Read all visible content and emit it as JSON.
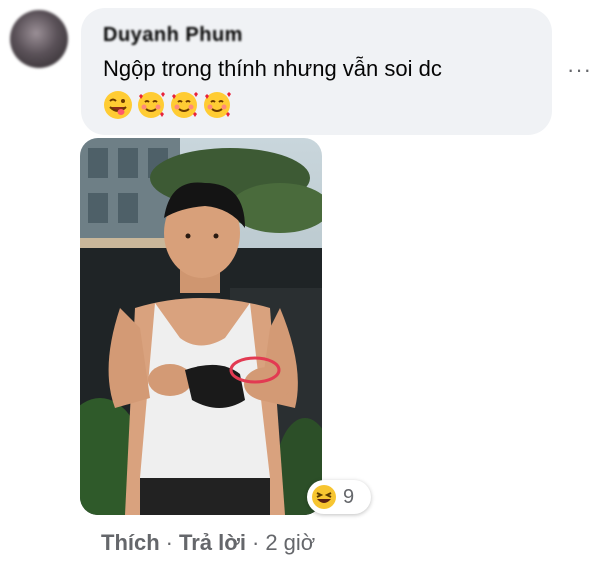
{
  "comment": {
    "author": "Duyanh Phum",
    "text": "Ngộp trong thính nhưng vẫn soi dc",
    "emojis": [
      "winking-tongue-emoji",
      "smiling-hearts-emoji",
      "smiling-hearts-emoji",
      "smiling-hearts-emoji"
    ],
    "more_label": "···"
  },
  "reaction": {
    "icon": "laughing-emoji",
    "count": "9"
  },
  "actions": {
    "like_label": "Thích",
    "reply_label": "Trả lời",
    "separator": "·",
    "time": "2 giờ"
  },
  "colors": {
    "bubble": "#f0f2f5",
    "text": "#050505",
    "meta": "#65676b"
  }
}
